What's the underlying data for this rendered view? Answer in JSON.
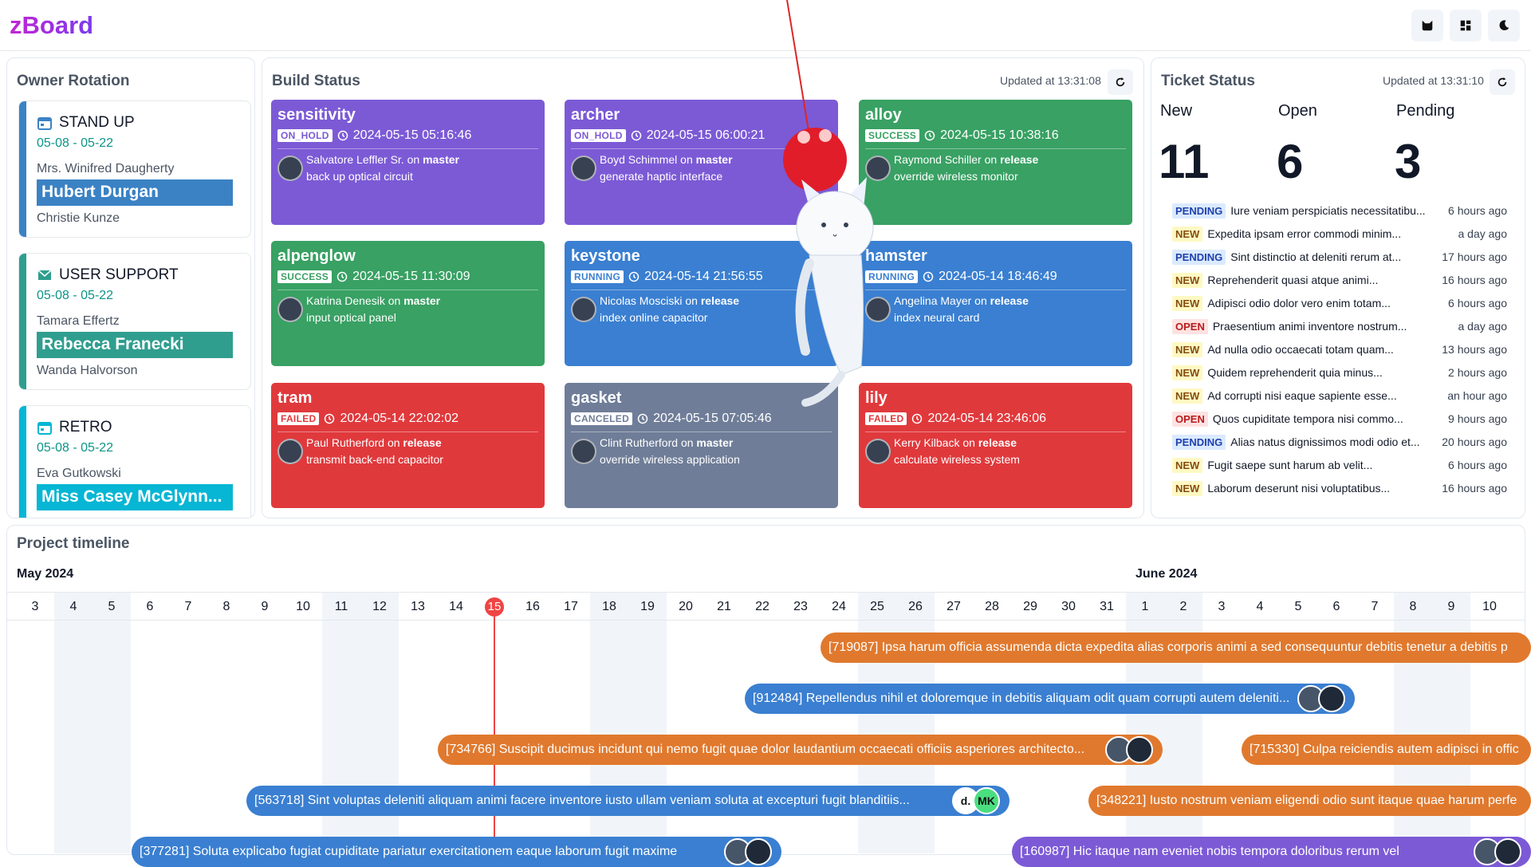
{
  "app": {
    "title": "zBoard"
  },
  "header": {
    "icons": [
      "cat-icon",
      "dashboard-icon",
      "moon-icon"
    ]
  },
  "owner_rotation": {
    "title": "Owner Rotation",
    "cards": [
      {
        "name": "STAND UP",
        "icon": "calendar-icon",
        "dates": "05-08 - 05-22",
        "previous": "Mrs. Winifred Daugherty",
        "current": "Hubert Durgan",
        "next": "Christie Kunze",
        "color": "#3b82c4"
      },
      {
        "name": "USER SUPPORT",
        "icon": "mail-icon",
        "dates": "05-08 - 05-22",
        "previous": "Tamara Effertz",
        "current": "Rebecca Franecki",
        "next": "Wanda Halvorson",
        "color": "#2f9e8f"
      },
      {
        "name": "RETRO",
        "icon": "calendar-icon",
        "dates": "05-08 - 05-22",
        "previous": "Eva Gutkowski",
        "current": "Miss Casey McGlynn...",
        "next": "",
        "color": "#06b6d4"
      }
    ]
  },
  "build_status": {
    "title": "Build Status",
    "updated": "Updated at 13:31:08",
    "builds": [
      {
        "name": "sensitivity",
        "status": "ON_HOLD",
        "time": "2024-05-15 05:16:46",
        "author": "Salvatore Leffler Sr.",
        "on": "on",
        "branch": "master",
        "desc": "back up optical circuit",
        "color": "#7c5ad6"
      },
      {
        "name": "archer",
        "status": "ON_HOLD",
        "time": "2024-05-15 06:00:21",
        "author": "Boyd Schimmel",
        "on": "on",
        "branch": "master",
        "desc": "generate haptic interface",
        "color": "#7c5ad6"
      },
      {
        "name": "alloy",
        "status": "SUCCESS",
        "time": "2024-05-15 10:38:16",
        "author": "Raymond Schiller",
        "on": "on",
        "branch": "release",
        "desc": "override wireless monitor",
        "color": "#38a163"
      },
      {
        "name": "alpenglow",
        "status": "SUCCESS",
        "time": "2024-05-15 11:30:09",
        "author": "Katrina Denesik",
        "on": "on",
        "branch": "master",
        "desc": "input optical panel",
        "color": "#38a163"
      },
      {
        "name": "keystone",
        "status": "RUNNING",
        "time": "2024-05-14 21:56:55",
        "author": "Nicolas Mosciski",
        "on": "on",
        "branch": "release",
        "desc": "index online capacitor",
        "color": "#3a7fd1"
      },
      {
        "name": "hamster",
        "status": "RUNNING",
        "time": "2024-05-14 18:46:49",
        "author": "Angelina Mayer",
        "on": "on",
        "branch": "release",
        "desc": "index neural card",
        "color": "#3a7fd1"
      },
      {
        "name": "tram",
        "status": "FAILED",
        "time": "2024-05-14 22:02:02",
        "author": "Paul Rutherford",
        "on": "on",
        "branch": "release",
        "desc": "transmit back-end capacitor",
        "color": "#e0393c"
      },
      {
        "name": "gasket",
        "status": "CANCELED",
        "time": "2024-05-15 07:05:46",
        "author": "Clint Rutherford",
        "on": "on",
        "branch": "master",
        "desc": "override wireless application",
        "color": "#6f7d98"
      },
      {
        "name": "lily",
        "status": "FAILED",
        "time": "2024-05-14 23:46:06",
        "author": "Kerry Kilback",
        "on": "on",
        "branch": "release",
        "desc": "calculate wireless system",
        "color": "#e0393c"
      }
    ]
  },
  "ticket_status": {
    "title": "Ticket Status",
    "updated": "Updated at 13:31:10",
    "counts": [
      {
        "label": "New",
        "value": "11"
      },
      {
        "label": "Open",
        "value": "6"
      },
      {
        "label": "Pending",
        "value": "3"
      }
    ],
    "tickets": [
      {
        "status": "PENDING",
        "text": "Iure veniam perspiciatis necessitatibu...",
        "time": "6 hours ago"
      },
      {
        "status": "NEW",
        "text": "Expedita ipsam error commodi minim...",
        "time": "a day ago"
      },
      {
        "status": "PENDING",
        "text": "Sint distinctio at deleniti rerum at...",
        "time": "17 hours ago"
      },
      {
        "status": "NEW",
        "text": "Reprehenderit quasi atque animi...",
        "time": "16 hours ago"
      },
      {
        "status": "NEW",
        "text": "Adipisci odio dolor vero enim totam...",
        "time": "6 hours ago"
      },
      {
        "status": "OPEN",
        "text": "Praesentium animi inventore nostrum...",
        "time": "a day ago"
      },
      {
        "status": "NEW",
        "text": "Ad nulla odio occaecati totam quam...",
        "time": "13 hours ago"
      },
      {
        "status": "NEW",
        "text": "Quidem reprehenderit quia minus...",
        "time": "2 hours ago"
      },
      {
        "status": "NEW",
        "text": "Ad corrupti nisi eaque sapiente esse...",
        "time": "an hour ago"
      },
      {
        "status": "OPEN",
        "text": "Quos cupiditate tempora nisi commo...",
        "time": "9 hours ago"
      },
      {
        "status": "PENDING",
        "text": "Alias natus dignissimos modi odio et...",
        "time": "20 hours ago"
      },
      {
        "status": "NEW",
        "text": "Fugit saepe sunt harum ab velit...",
        "time": "6 hours ago"
      },
      {
        "status": "NEW",
        "text": "Laborum deserunt nisi voluptatibus...",
        "time": "16 hours ago"
      }
    ],
    "badge_colors": {
      "PENDING": {
        "bg": "#dbeafe",
        "fg": "#1e40af"
      },
      "NEW": {
        "bg": "#fef9c3",
        "fg": "#854d0e"
      },
      "OPEN": {
        "bg": "#fee2e2",
        "fg": "#b91c1c"
      }
    }
  },
  "timeline": {
    "title": "Project timeline",
    "months": [
      "May 2024",
      "June 2024"
    ],
    "days": [
      "3",
      "4",
      "5",
      "6",
      "7",
      "8",
      "9",
      "10",
      "11",
      "12",
      "13",
      "14",
      "15",
      "16",
      "17",
      "18",
      "19",
      "20",
      "21",
      "22",
      "23",
      "24",
      "25",
      "26",
      "27",
      "28",
      "29",
      "30",
      "31",
      "1",
      "2",
      "3",
      "4",
      "5",
      "6",
      "7",
      "8",
      "9",
      "10"
    ],
    "today": "15",
    "tasks": [
      {
        "label": "[719087] Ipsa harum officia assumenda dicta expedita alias corporis animi a sed consequuntur debitis tenetur a debitis p",
        "color": "#e0792e",
        "avatars": []
      },
      {
        "label": "[912484] Repellendus nihil et doloremque in debitis aliquam odit quam corrupti autem deleniti...",
        "color": "#3a7fd1",
        "avatars": [
          "",
          ""
        ]
      },
      {
        "label": "[734766] Suscipit ducimus incidunt qui nemo fugit quae dolor laudantium occaecati officiis asperiores architecto...",
        "color": "#e0792e",
        "avatars": [
          "",
          ""
        ]
      },
      {
        "label": "[715330] Culpa reiciendis autem adipisci in offic",
        "color": "#e0792e",
        "avatars": []
      },
      {
        "label": "[563718] Sint voluptas deleniti aliquam animi facere inventore iusto ullam veniam soluta at excepturi fugit blanditiis...",
        "color": "#3a7fd1",
        "avatars": [
          "d.",
          "MK"
        ]
      },
      {
        "label": "[348221] Iusto nostrum veniam eligendi odio sunt itaque quae harum perfe",
        "color": "#e0792e",
        "avatars": []
      },
      {
        "label": "[377281] Soluta explicabo fugiat cupiditate pariatur exercitationem eaque laborum fugit maxime",
        "color": "#3a7fd1",
        "avatars": [
          "",
          ""
        ]
      },
      {
        "label": "[160987] Hic itaque nam eveniet nobis tempora doloribus rerum vel",
        "color": "#7c5ad6",
        "avatars": [
          "",
          ""
        ]
      }
    ]
  }
}
